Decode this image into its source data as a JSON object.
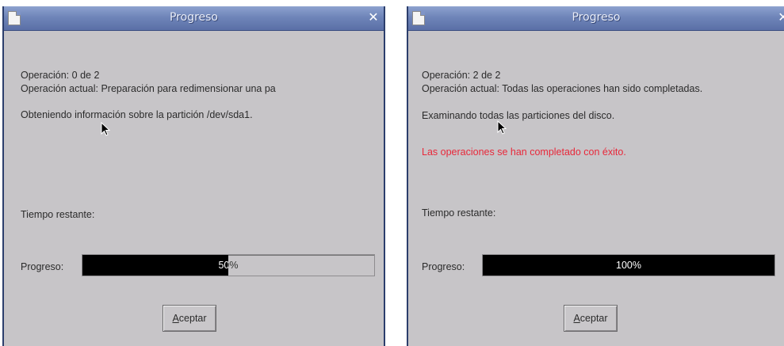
{
  "dialogs": [
    {
      "title": "Progreso",
      "operation_label": "Operación:",
      "operation_value": "0 de 2",
      "current_label": "Operación actual:",
      "current_value": "Preparación para redimensionar una pa",
      "status": "Obteniendo información sobre la partición /dev/sda1.",
      "result": "",
      "time_label": "Tiempo restante:",
      "progress_label": "Progreso:",
      "progress_value": 0.5,
      "progress_text": "50%",
      "ok_button_accel": "A",
      "ok_button_rest": "ceptar"
    },
    {
      "title": "Progreso",
      "operation_label": "Operación:",
      "operation_value": "2 de 2",
      "current_label": "Operación actual:",
      "current_value": "Todas las operaciones han sido completadas.",
      "status": "Examinando todas las particiones del disco.",
      "result": "Las operaciones se han completado con éxito.",
      "time_label": "Tiempo restante:",
      "progress_label": "Progreso:",
      "progress_value": 1.0,
      "progress_text": "100%",
      "ok_button_accel": "A",
      "ok_button_rest": "ceptar"
    }
  ],
  "icons": {
    "window": "window-icon",
    "close": "close-icon",
    "pointer": "mouse-pointer-icon"
  },
  "colors": {
    "titlebar": "#6f85b9",
    "dialog_bg": "#c7c5c8",
    "success_text": "#e8283a",
    "progress_fill": "#000000"
  }
}
